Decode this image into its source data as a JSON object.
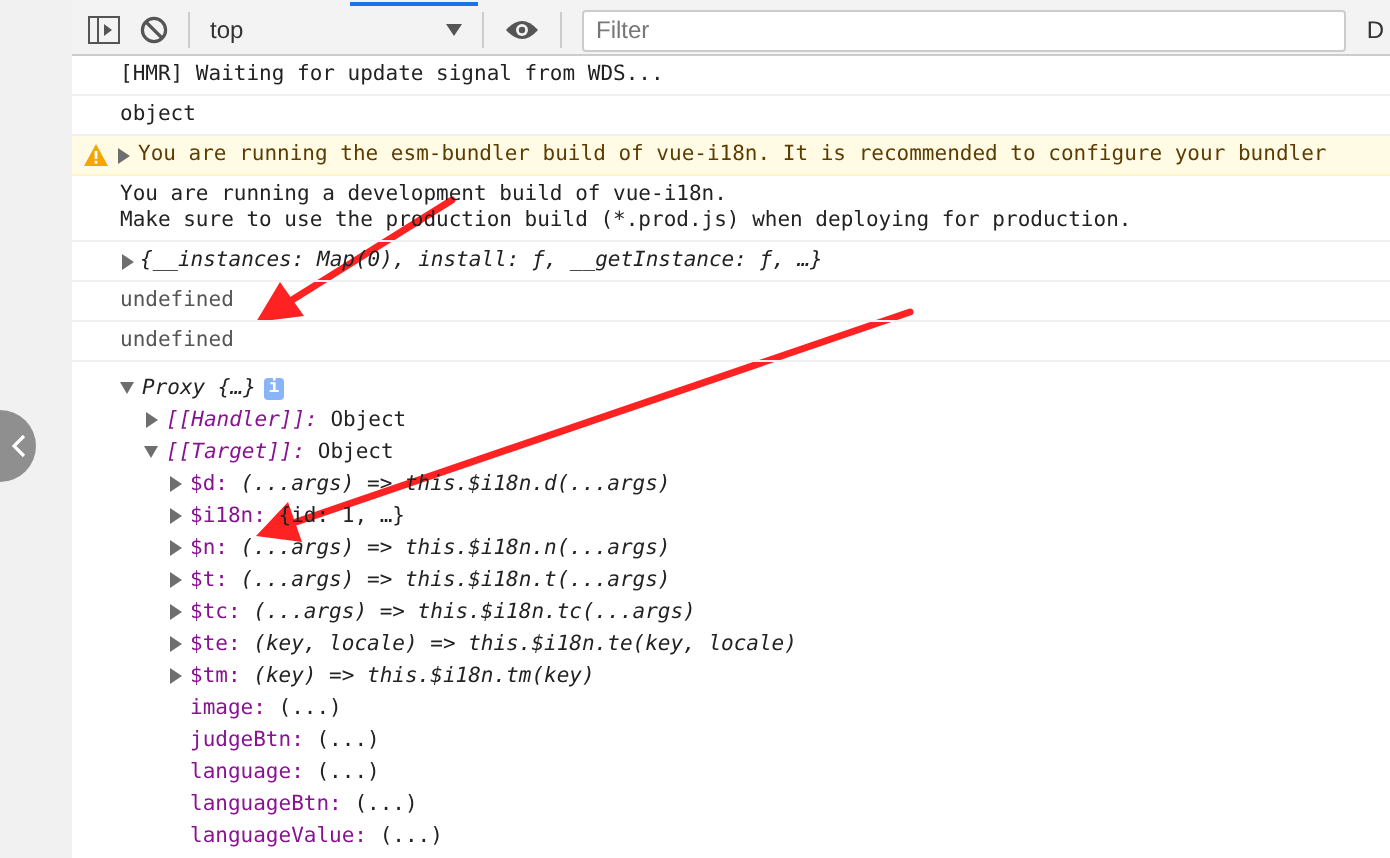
{
  "toolbar": {
    "context": "top",
    "filter": {
      "placeholder": "Filter"
    },
    "cut_label": "D"
  },
  "messages": [
    {
      "kind": "log",
      "lines": [
        "[HMR] Waiting for update signal from WDS..."
      ]
    },
    {
      "kind": "log",
      "lines": [
        "object"
      ]
    },
    {
      "kind": "warning",
      "expanded": false,
      "text": "You are running the esm-bundler build of vue-i18n. It is recommended to configure your bundler"
    },
    {
      "kind": "log",
      "lines": [
        "You are running a development build of vue-i18n.",
        "Make sure to use the production build (*.prod.js) when deploying for production."
      ]
    },
    {
      "kind": "object",
      "expanded": false,
      "text": "{__instances: Map(0), install: ƒ, __getInstance: ƒ, …}"
    },
    {
      "kind": "result",
      "lines": [
        "undefined"
      ]
    },
    {
      "kind": "result",
      "lines": [
        "undefined"
      ]
    },
    {
      "kind": "tree",
      "root": {
        "label": "Proxy {…}",
        "expanded": true,
        "badge": "i",
        "children": [
          {
            "key": "[[Handler]]:",
            "kind": "internal",
            "expanded": false,
            "value": "Object"
          },
          {
            "key": "[[Target]]:",
            "kind": "internal",
            "expanded": true,
            "value": "Object",
            "children": [
              {
                "key": "$d:",
                "kind": "function",
                "expanded": false,
                "value": "(...args) => this.$i18n.d(...args)"
              },
              {
                "key": "$i18n:",
                "kind": "object",
                "expanded": false,
                "value": "{id: 1, …}"
              },
              {
                "key": "$n:",
                "kind": "function",
                "expanded": false,
                "value": "(...args) => this.$i18n.n(...args)"
              },
              {
                "key": "$t:",
                "kind": "function",
                "expanded": false,
                "value": "(...args) => this.$i18n.t(...args)"
              },
              {
                "key": "$tc:",
                "kind": "function",
                "expanded": false,
                "value": "(...args) => this.$i18n.tc(...args)"
              },
              {
                "key": "$te:",
                "kind": "function",
                "expanded": false,
                "value": "(key, locale) => this.$i18n.te(key, locale)"
              },
              {
                "key": "$tm:",
                "kind": "function",
                "expanded": false,
                "value": "(key) => this.$i18n.tm(key)"
              },
              {
                "key": "image:",
                "kind": "getter",
                "value": "(...)"
              },
              {
                "key": "judgeBtn:",
                "kind": "getter",
                "value": "(...)"
              },
              {
                "key": "language:",
                "kind": "getter",
                "value": "(...)"
              },
              {
                "key": "languageBtn:",
                "kind": "getter",
                "value": "(...)"
              },
              {
                "key": "languageValue:",
                "kind": "getter",
                "value": "(...)"
              }
            ]
          }
        ]
      }
    }
  ]
}
